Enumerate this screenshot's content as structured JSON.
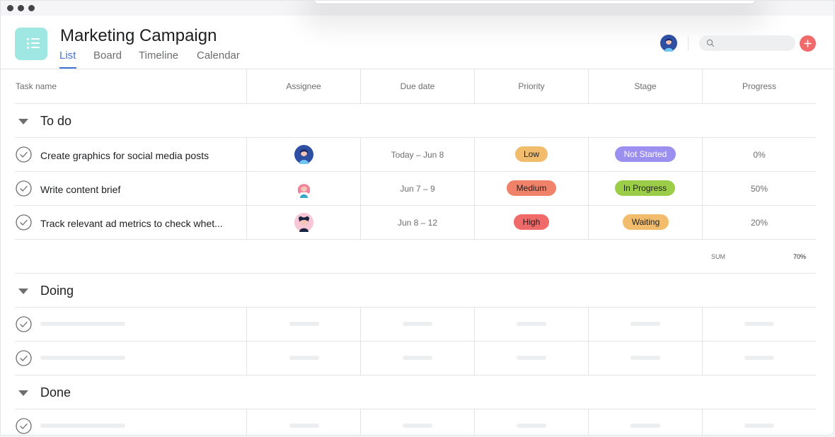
{
  "project": {
    "title": "Marketing Campaign",
    "tabs": [
      {
        "label": "List",
        "active": true
      },
      {
        "label": "Board",
        "active": false
      },
      {
        "label": "Timeline",
        "active": false
      },
      {
        "label": "Calendar",
        "active": false
      }
    ]
  },
  "search": {
    "placeholder": ""
  },
  "columns": [
    "Task name",
    "Assignee",
    "Due date",
    "Priority",
    "Stage",
    "Progress"
  ],
  "sections": [
    {
      "title": "To do",
      "tasks": [
        {
          "name": "Create graphics for social media posts",
          "assignee": "avatar-blue",
          "due": "Today – Jun 8",
          "priority": "Low",
          "stage": "Not Started",
          "progress": "0%"
        },
        {
          "name": "Write content brief",
          "assignee": "avatar-pink",
          "due": "Jun 7 – 9",
          "priority": "Medium",
          "stage": "In Progress",
          "progress": "50%"
        },
        {
          "name": "Track relevant ad metrics to check whet...",
          "assignee": "avatar-navy",
          "due": "Jun 8 – 12",
          "priority": "High",
          "stage": "Waiting",
          "progress": "20%"
        }
      ],
      "summary": {
        "label": "SUM",
        "value": "70%"
      }
    },
    {
      "title": "Doing"
    },
    {
      "title": "Done"
    }
  ],
  "colors": {
    "accent": "#4573d2",
    "icon_teal": "#9ee7e3",
    "add_button": "#f06a6a",
    "priority_low": "#f1bd6c",
    "priority_medium": "#f1826a",
    "priority_high": "#f06a6a",
    "stage_not_started": "#9b8ff0",
    "stage_in_progress": "#9ccd48",
    "stage_waiting": "#f1bd6c"
  },
  "icons": {
    "project": "list-icon",
    "search": "search-icon",
    "add": "plus-icon",
    "check": "check-circle-icon",
    "caret": "caret-down-icon"
  }
}
